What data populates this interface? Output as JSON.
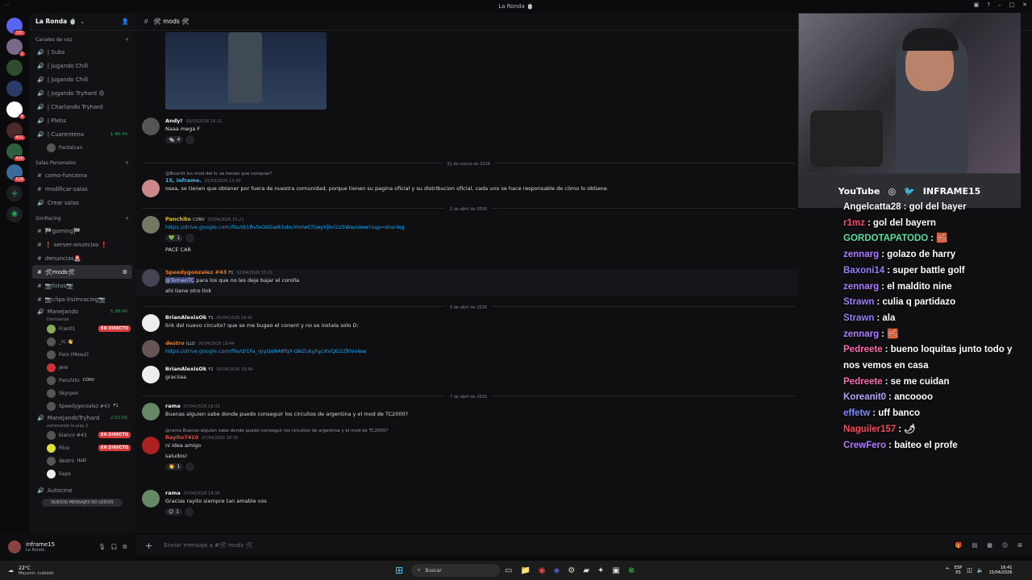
{
  "titlebar": {
    "title": "La Ronda 🍵"
  },
  "servers": [
    {
      "badge": "181"
    },
    {
      "badge": "2"
    },
    {
      "badge": ""
    },
    {
      "badge": ""
    },
    {
      "badge": "8"
    },
    {
      "badge": "401"
    },
    {
      "badge": "430"
    },
    {
      "badge": "528"
    }
  ],
  "guild": {
    "name": "La Ronda 🍵"
  },
  "sidebar": {
    "cat_voice": "Canales de voz",
    "voice": [
      {
        "name": "| Subs",
        "time": ""
      },
      {
        "name": "| Jugando Chill",
        "time": ""
      },
      {
        "name": "| Jugando Chill",
        "time": ""
      },
      {
        "name": "| Jugando Tryhard 😡",
        "time": ""
      },
      {
        "name": "| Charlando Tryhard",
        "time": ""
      },
      {
        "name": "| Plebs",
        "time": ""
      },
      {
        "name": "| Cuarentena",
        "time": "1:40:44"
      }
    ],
    "cuarentena_user": "Pantalcan",
    "cat_private": "Salas Personales",
    "private": [
      "como-funciona",
      "modificar-salas",
      "Crear salas"
    ],
    "cat_sim": "SimRacing",
    "sim": [
      {
        "name": "🏁gaming🏁"
      },
      {
        "name": "❗ server-anuncios ❗"
      },
      {
        "name": "denuncias🚨"
      },
      {
        "name": "🛠mods🛠"
      },
      {
        "name": "📷fotos📷"
      },
      {
        "name": "📷clips-lrsimracing📷"
      }
    ],
    "manejando": {
      "name": "Manejando",
      "time": "5:38:40",
      "status": "Dormiendo"
    },
    "manejando_users": [
      {
        "name": "Fran01",
        "live": "EN DIRECTO"
      },
      {
        "name": "_rc 👋",
        "live": ""
      },
      {
        "name": "Fero (Mosul)",
        "live": ""
      },
      {
        "name": "Jere",
        "live": ""
      },
      {
        "name": "Panchito",
        "tag": "CONV",
        "live": ""
      },
      {
        "name": "Skyrpon",
        "live": ""
      },
      {
        "name": "Speedygonzalez #43",
        "tag": "F1",
        "live": ""
      }
    ],
    "tryhard": {
      "name": "ManejandoTryhard",
      "time": "2:02:56",
      "status": "estrenando la play 2"
    },
    "tryhard_users": [
      {
        "name": "bianco #43",
        "live": "EN DIRECTO"
      },
      {
        "name": "Filco",
        "live": "EN DIRECTO"
      },
      {
        "name": "destro",
        "tag": "ILLO",
        "live": ""
      },
      {
        "name": "Sapx",
        "live": ""
      }
    ],
    "autocine": "Autocine",
    "unread": "NUEVOS MENSAJES NO LEÍDOS"
  },
  "user": {
    "name": "inframe15",
    "status": "La Ronda"
  },
  "channel": {
    "name": "🛠 mods 🛠"
  },
  "messages": {
    "andy": {
      "name": "Andy!",
      "ts": "30/03/2026 16:11",
      "text": "Naaa mega F",
      "react": "4"
    },
    "d1": "31 de marzo de 2026",
    "inf": {
      "reply": "@Boonilt los mod del tc se tienen que comprar?",
      "name": "15, inframe.",
      "ts": "31/03/2026 13:39",
      "text": "osea, se tienen que obtener por fuera de nuestra comunidad, porque tienen su pagina oficial y su distribucion oficial, cada uno se hace responsable de cómo lo obtiene."
    },
    "d2": "2 de abril de 2026",
    "pan": {
      "name": "Panchito",
      "tag": "CONV",
      "ts": "02/04/2026 15:21",
      "link": "https://drive.google.com/file/d/1RvfeOXGw03xbuYmlwCfGeyVjlvI1USWw/view?usp=sharing",
      "react": "1",
      "text": "PACE CAR"
    },
    "speedy": {
      "name": "Speedygonzalez #43",
      "tag": "F1",
      "ts": "02/04/2026 15:21",
      "mention": "@TorneoTC",
      "text": "para los que no les deje bajar el corolla",
      "text2": "ahi tiene otro link"
    },
    "d3": "5 de abril de 2026",
    "brian1": {
      "name": "BrianAlexisOk",
      "tag": "F1",
      "ts": "05/04/2026 18:41",
      "text": "link del nuevo circuito? que se me bugeo el conent y no se instala solo D:"
    },
    "destro": {
      "name": "destro",
      "tag": "ILLO",
      "ts": "05/04/2026 18:44",
      "link": "https://drive.google.com/file/d/1Fa_rpyQo9A8fqY-GNZukyhyLKVQG2Zkh/view"
    },
    "brian2": {
      "name": "BrianAlexisOk",
      "tag": "F1",
      "ts": "05/04/2026 18:49",
      "text": "graciiaa"
    },
    "d4": "7 de abril de 2026",
    "rama1": {
      "name": "rama",
      "ts": "07/04/2026 18:33",
      "text": "Buenas alguien sabe donde puedo conseguir los circuitos de argentina y el mod de TC2000?"
    },
    "rayito": {
      "reply": "@rama Buenas alguien sabe donde puedo conseguir los circuitos de argentina y el mod de TC2000?",
      "name": "Rayito7410",
      "ts": "07/04/2026 18:35",
      "text": "ni idea amigo",
      "text2": "saludos!",
      "react": "1"
    },
    "rama2": {
      "name": "rama",
      "ts": "07/04/2026 18:38",
      "text": "Gracias rayito siempre tan amable vos",
      "react": "1"
    }
  },
  "composer": {
    "placeholder": "Enviar mensaje a #🛠 mods 🛠"
  },
  "overlay": {
    "social": [
      "YouTube",
      "INFRAME15"
    ],
    "chat": [
      {
        "user": "Angelcatta28",
        "color": "#ffffff",
        "text": ": gol del bayer"
      },
      {
        "user": "r1mz",
        "color": "#ff4466",
        "text": ": gol del bayern"
      },
      {
        "user": "GORDOTAPATODO",
        "color": "#58e0a0",
        "text": ": 🧱"
      },
      {
        "user": "zennarg",
        "color": "#b07cff",
        "text": ": golazo de harry"
      },
      {
        "user": "Baxoni14",
        "color": "#9b7bff",
        "text": ": super battle golf"
      },
      {
        "user": "zennarg",
        "color": "#b07cff",
        "text": ": el maldito nine"
      },
      {
        "user": "Strawn",
        "color": "#9b7bff",
        "text": ": culia q partidazo"
      },
      {
        "user": "Strawn",
        "color": "#9b7bff",
        "text": ": ala"
      },
      {
        "user": "zennarg",
        "color": "#b07cff",
        "text": ": 🧱"
      },
      {
        "user": "Pedreete",
        "color": "#ff6ab0",
        "text": ": bueno loquitas junto todo y nos vemos en casa"
      },
      {
        "user": "Pedreete",
        "color": "#ff6ab0",
        "text": ": se me cuidan"
      },
      {
        "user": "Koreanit0",
        "color": "#b7a3ff",
        "text": ": ancoooo"
      },
      {
        "user": "effetw",
        "color": "#7c8cff",
        "text": ": uff banco"
      },
      {
        "user": "Naguiler157",
        "color": "#ff4455",
        "text": ": 🌶"
      },
      {
        "user": "CrewFero",
        "color": "#b07cff",
        "text": ": baiteo el profe"
      }
    ]
  },
  "taskbar": {
    "weather_temp": "22°C",
    "weather_desc": "Mayorm. nublado",
    "search": "Buscar",
    "lang": "ESP",
    "lang2": "ES",
    "time": "16:41",
    "date": "15/04/2026"
  }
}
